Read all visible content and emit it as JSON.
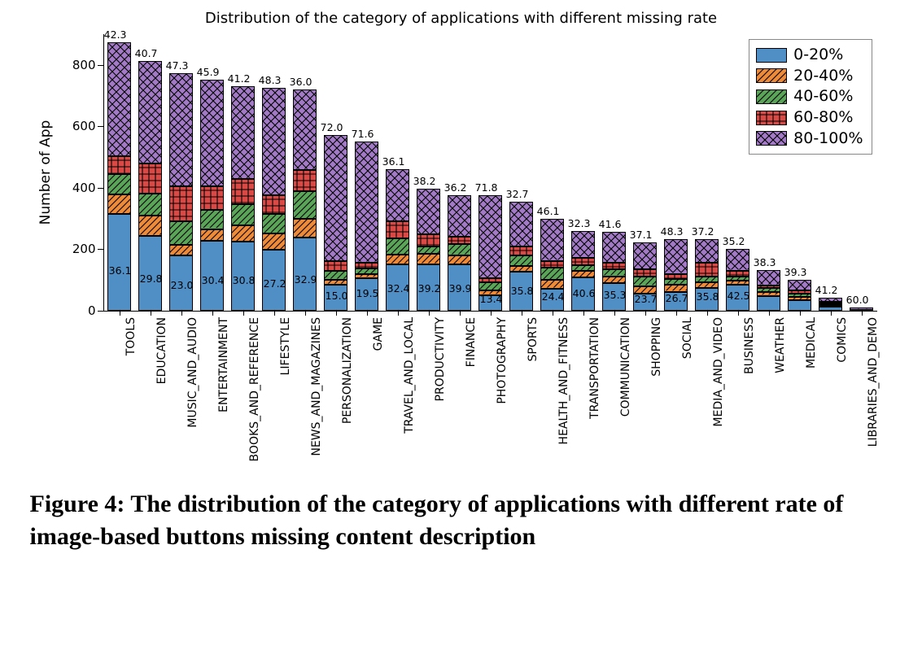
{
  "chart_data": {
    "type": "bar",
    "stacked": true,
    "title": "Distribution of the category of applications with different missing rate",
    "ylabel": "Number of App",
    "xlabel": "",
    "ylim": [
      0,
      900
    ],
    "yticks": [
      0,
      200,
      400,
      600,
      800
    ],
    "categories": [
      "TOOLS",
      "EDUCATION",
      "MUSIC_AND_AUDIO",
      "ENTERTAINMENT",
      "BOOKS_AND_REFERENCE",
      "LIFESTYLE",
      "NEWS_AND_MAGAZINES",
      "PERSONALIZATION",
      "GAME",
      "TRAVEL_AND_LOCAL",
      "PRODUCTIVITY",
      "FINANCE",
      "PHOTOGRAPHY",
      "SPORTS",
      "HEALTH_AND_FITNESS",
      "TRANSPORTATION",
      "COMMUNICATION",
      "SHOPPING",
      "SOCIAL",
      "MEDIA_AND_VIDEO",
      "BUSINESS",
      "WEATHER",
      "MEDICAL",
      "COMICS",
      "LIBRARIES_AND_DEMO"
    ],
    "series": [
      {
        "name": "0-20%",
        "color": "#4f8fc6",
        "hatch": "",
        "values": [
          316,
          244,
          179,
          229,
          225,
          198,
          238,
          86,
          107,
          151,
          152,
          150,
          51,
          127,
          72,
          108,
          90,
          56,
          62,
          75,
          85,
          49,
          35,
          14,
          2
        ]
      },
      {
        "name": "20-40%",
        "color": "#ee8a38",
        "hatch": "diag",
        "values": [
          63,
          65,
          35,
          37,
          54,
          53,
          61,
          15,
          11,
          31,
          33,
          30,
          14,
          18,
          28,
          22,
          22,
          24,
          22,
          18,
          12,
          11,
          10,
          4,
          0
        ]
      },
      {
        "name": "40-60%",
        "color": "#5aa558",
        "hatch": "diag",
        "values": [
          67,
          72,
          77,
          61,
          68,
          63,
          90,
          28,
          20,
          54,
          25,
          36,
          28,
          35,
          40,
          18,
          22,
          30,
          18,
          18,
          14,
          13,
          10,
          7,
          0
        ]
      },
      {
        "name": "60-80%",
        "color": "#d94a46",
        "hatch": "grid",
        "values": [
          58,
          98,
          113,
          78,
          82,
          62,
          70,
          32,
          19,
          55,
          40,
          24,
          13,
          30,
          22,
          25,
          23,
          24,
          18,
          45,
          19,
          10,
          10,
          4,
          2
        ]
      },
      {
        "name": "80-100%",
        "color": "#a27ac6",
        "hatch": "cross",
        "values": [
          370,
          333,
          368,
          348,
          301,
          350,
          261,
          412,
          393,
          169,
          148,
          136,
          270,
          145,
          136,
          86,
          100,
          88,
          112,
          78,
          70,
          49,
          35,
          14,
          6
        ]
      }
    ],
    "top_labels": [
      "42.3",
      "40.7",
      "47.3",
      "45.9",
      "41.2",
      "48.3",
      "36.0",
      "72.0",
      "71.6",
      "36.1",
      "38.2",
      "36.2",
      "71.8",
      "32.7",
      "46.1",
      "32.3",
      "41.6",
      "37.1",
      "48.3",
      "37.2",
      "35.2",
      "38.3",
      "39.3",
      "41.2",
      "60.0"
    ],
    "bottom_labels": [
      "36.1",
      "29.8",
      "23.0",
      "30.4",
      "30.8",
      "27.2",
      "32.9",
      "15.0",
      "19.5",
      "32.4",
      "39.2",
      "39.9",
      "13.4",
      "35.8",
      "24.4",
      "40.6",
      "35.3",
      "23.7",
      "26.7",
      "35.8",
      "42.5",
      "",
      "",
      "",
      ""
    ],
    "legend_position": "upper-right"
  },
  "caption": "Figure 4: The distribution of the category of applications with different rate of image-based buttons missing content description"
}
